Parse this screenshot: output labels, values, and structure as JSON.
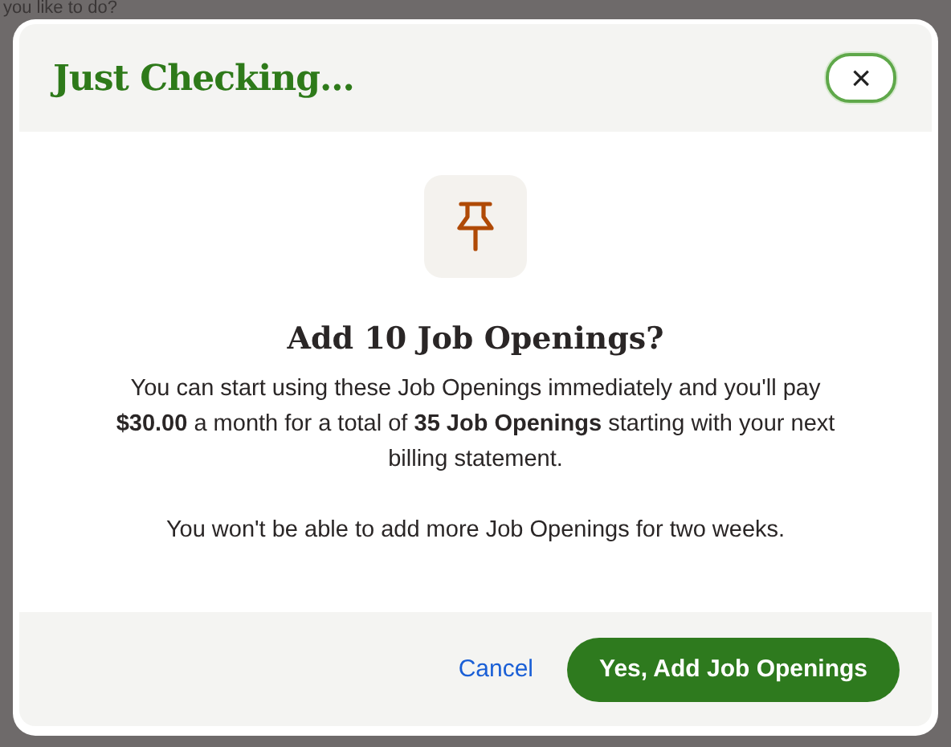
{
  "background_text": "you like to do?",
  "dialog": {
    "title": "Just Checking...",
    "close_label": "×",
    "heading": "Add 10 Job Openings?",
    "paragraphs": [
      "You can start using these Job Openings immediately and you'll pay **$30.00** a month for a total of **35 Job Openings** starting with your next billing statement.",
      "You won't be able to add more Job Openings for two weeks."
    ],
    "cancel": "Cancel",
    "confirm": "Yes, Add Job Openings"
  }
}
